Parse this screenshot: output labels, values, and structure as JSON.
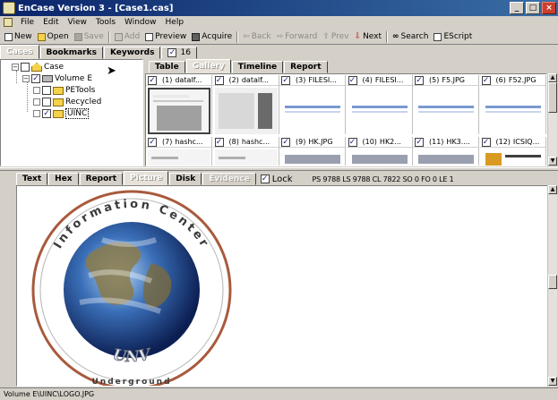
{
  "window": {
    "title": "EnCase Version 3 - [Case1.cas]"
  },
  "menu": [
    "File",
    "Edit",
    "View",
    "Tools",
    "Window",
    "Help"
  ],
  "toolbar": {
    "new": "New",
    "open": "Open",
    "save": "Save",
    "add": "Add",
    "preview": "Preview",
    "acquire": "Acquire",
    "back": "Back",
    "forward": "Forward",
    "prev": "Prev",
    "next": "Next",
    "search": "Search",
    "escript": "EScript"
  },
  "left_tabs": {
    "cases": "Cases",
    "bookmarks": "Bookmarks",
    "keywords": "Keywords",
    "count": "16"
  },
  "tree": {
    "case": "Case",
    "volume": "Volume E",
    "children": [
      "PETools",
      "Recycled",
      "UINC"
    ]
  },
  "right_tabs": [
    "Table",
    "Gallery",
    "Timeline",
    "Report"
  ],
  "gallery": {
    "row1": [
      {
        "num": "(1)",
        "name": "datalf..."
      },
      {
        "num": "(2)",
        "name": "datalf..."
      },
      {
        "num": "(3)",
        "name": "FILESI..."
      },
      {
        "num": "(4)",
        "name": "FILESI..."
      },
      {
        "num": "(5)",
        "name": "F5.JPG"
      },
      {
        "num": "(6)",
        "name": "F52.JPG"
      }
    ],
    "row2": [
      {
        "num": "(7)",
        "name": "hashc..."
      },
      {
        "num": "(8)",
        "name": "hashc..."
      },
      {
        "num": "(9)",
        "name": "HK.JPG"
      },
      {
        "num": "(10)",
        "name": "HK2..."
      },
      {
        "num": "(11)",
        "name": "HK3...."
      },
      {
        "num": "(12)",
        "name": "ICSIQ..."
      }
    ]
  },
  "bottom_tabs": [
    "Text",
    "Hex",
    "Report",
    "Picture",
    "Disk",
    "Evidence"
  ],
  "lock_label": "Lock",
  "position_info": "PS 9788  LS 9788  CL 7822  SO 0  FO 0  LE 1",
  "logo": {
    "top_text": "Information Center",
    "bottom_text": "Underground",
    "monogram": "UNV"
  },
  "status": "Volume E\\UINC\\LOGO.JPG",
  "colors": {
    "title_bar": "#0a246a",
    "face": "#d4d0c8",
    "check": "#1c1c8a"
  }
}
